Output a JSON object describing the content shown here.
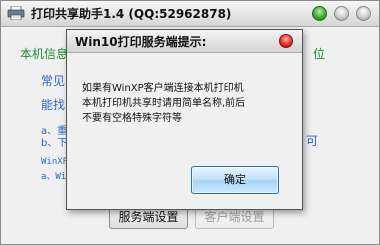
{
  "window": {
    "title": "打印共享助手1.4   (QQ:52962878)"
  },
  "background": {
    "info_label": "本机信息",
    "info_suffix": "位",
    "common_label": "常见",
    "can_find_label": "能找",
    "step_a": "a、重",
    "step_b": "b、下",
    "step_b_suffix": "可",
    "winxp_line": "WinXP",
    "winxp_sub": "a、Wi",
    "server_settings_button": "服务端设置",
    "client_settings_button": "客户端设置"
  },
  "dialog": {
    "title": "Win10打印服务端提示:",
    "message_lines": [
      "如果有WinXP客户端连接本机打印机",
      "本机打印机共享时请用简单名称,前后",
      "不要有空格特殊字符等"
    ],
    "ok_button": "确定"
  },
  "colors": {
    "green_text": "#1a8f2e",
    "blue_text": "#2a66c4",
    "ok_button_border": "#2f6ea8"
  }
}
